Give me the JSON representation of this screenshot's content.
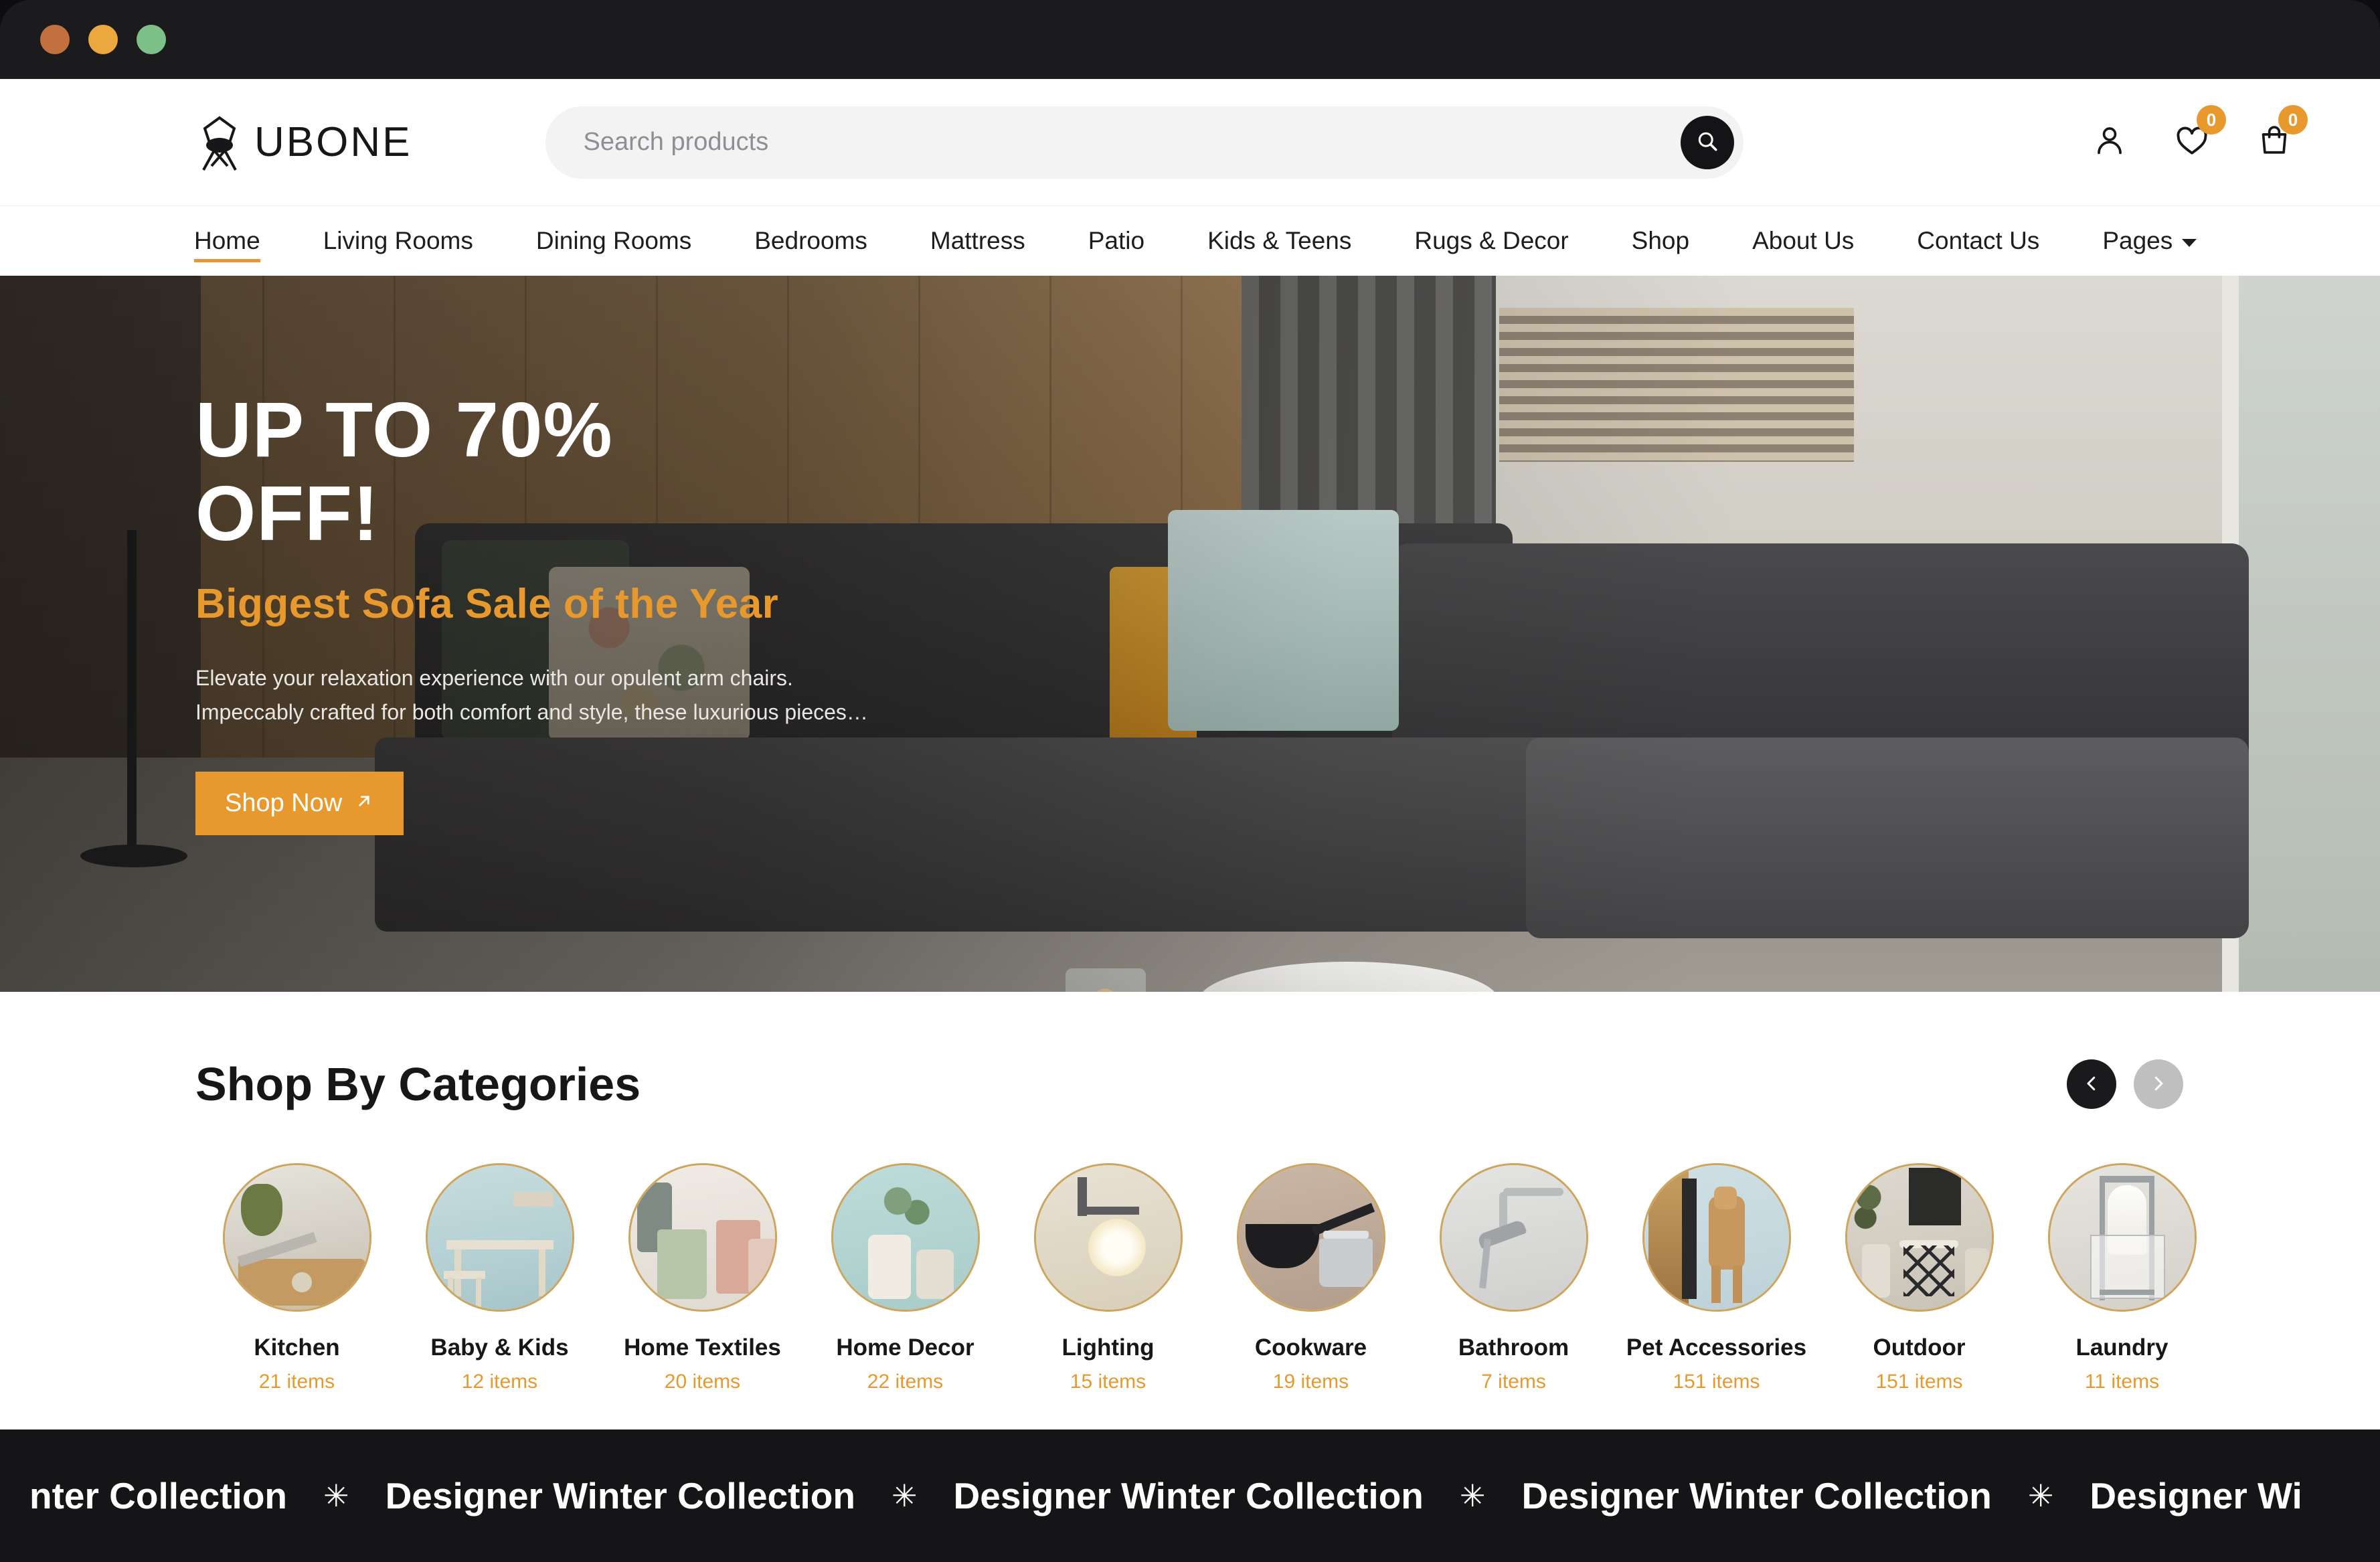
{
  "window": {
    "controls": [
      "close",
      "minimize",
      "maximize"
    ]
  },
  "header": {
    "brand": "UBONE",
    "brand_icon": "chair-logo-icon",
    "search": {
      "placeholder": "Search products",
      "value": "",
      "button_icon": "search-icon"
    },
    "actions": [
      {
        "name": "account",
        "icon": "user-icon",
        "badge": null
      },
      {
        "name": "wishlist",
        "icon": "heart-icon",
        "badge": "0"
      },
      {
        "name": "cart",
        "icon": "shopping-bag-icon",
        "badge": "0"
      }
    ]
  },
  "nav": {
    "items": [
      {
        "label": "Home",
        "active": true,
        "dropdown": false
      },
      {
        "label": "Living Rooms",
        "active": false,
        "dropdown": false
      },
      {
        "label": "Dining Rooms",
        "active": false,
        "dropdown": false
      },
      {
        "label": "Bedrooms",
        "active": false,
        "dropdown": false
      },
      {
        "label": "Mattress",
        "active": false,
        "dropdown": false
      },
      {
        "label": "Patio",
        "active": false,
        "dropdown": false
      },
      {
        "label": "Kids & Teens",
        "active": false,
        "dropdown": false
      },
      {
        "label": "Rugs & Decor",
        "active": false,
        "dropdown": false
      },
      {
        "label": "Shop",
        "active": false,
        "dropdown": false
      },
      {
        "label": "About Us",
        "active": false,
        "dropdown": false
      },
      {
        "label": "Contact Us",
        "active": false,
        "dropdown": false
      },
      {
        "label": "Pages",
        "active": false,
        "dropdown": true
      }
    ]
  },
  "hero": {
    "headline": "UP TO 70% OFF!",
    "subheadline": "Biggest Sofa Sale of the Year",
    "description_line1": "Elevate your relaxation experience with our opulent arm chairs.",
    "description_line2": "Impeccably crafted for both comfort and style, these luxurious pieces…",
    "cta_label": "Shop Now",
    "cta_icon": "arrow-up-right-icon"
  },
  "categories": {
    "title": "Shop By Categories",
    "prev_icon": "chevron-left-icon",
    "next_icon": "chevron-right-icon",
    "items": [
      {
        "name": "Kitchen",
        "count": "21 items"
      },
      {
        "name": "Baby & Kids",
        "count": "12 items"
      },
      {
        "name": "Home Textiles",
        "count": "20 items"
      },
      {
        "name": "Home Decor",
        "count": "22 items"
      },
      {
        "name": "Lighting",
        "count": "15 items"
      },
      {
        "name": "Cookware",
        "count": "19 items"
      },
      {
        "name": "Bathroom",
        "count": "7 items"
      },
      {
        "name": "Pet Accessories",
        "count": "151 items"
      },
      {
        "name": "Outdoor",
        "count": "151 items"
      },
      {
        "name": "Laundry",
        "count": "11 items"
      }
    ]
  },
  "marquee": {
    "text": "Designer Winter Collection",
    "separator": "✳",
    "items": [
      "nter Collection",
      "Designer Winter Collection",
      "Designer Winter Collection",
      "Designer Winter Collection",
      "Designer Wi"
    ]
  },
  "colors": {
    "accent": "#e8992e",
    "dark": "#151517",
    "text": "#17171a",
    "search_bg": "#f3f3f4",
    "circle_border": "#cda55f"
  }
}
